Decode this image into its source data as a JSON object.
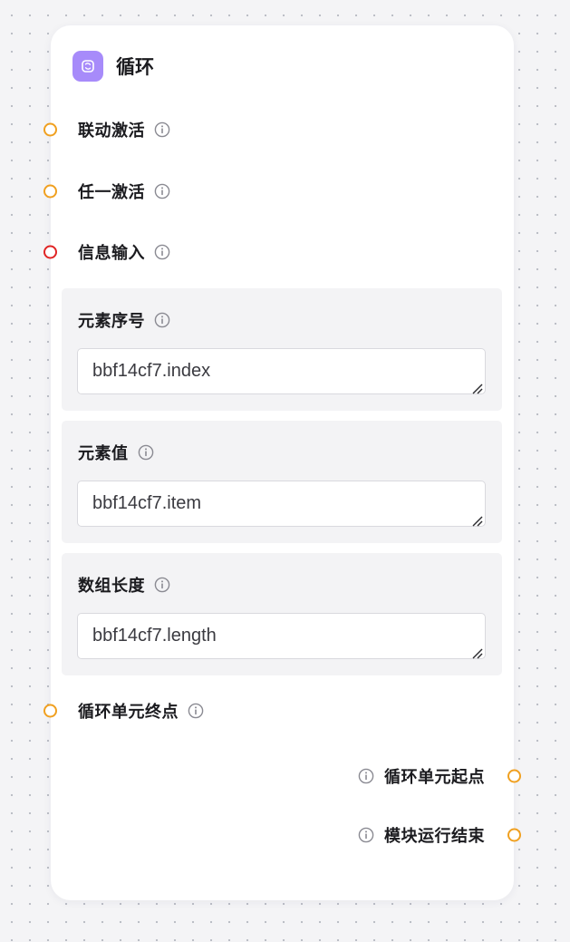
{
  "node": {
    "title": "循环",
    "icon": "loop-icon",
    "accent": "#a78bfa"
  },
  "ports": {
    "linked_activate": "联动激活",
    "any_activate": "任一激活",
    "info_input": "信息输入",
    "loop_unit_end": "循环单元终点",
    "loop_unit_start": "循环单元起点",
    "module_run_end": "模块运行结束"
  },
  "fields": [
    {
      "label": "元素序号",
      "value": "bbf14cf7.index"
    },
    {
      "label": "元素值",
      "value": "bbf14cf7.item"
    },
    {
      "label": "数组长度",
      "value": "bbf14cf7.length"
    }
  ],
  "colors": {
    "port_default": "#f0a020",
    "port_required": "#e02424"
  }
}
